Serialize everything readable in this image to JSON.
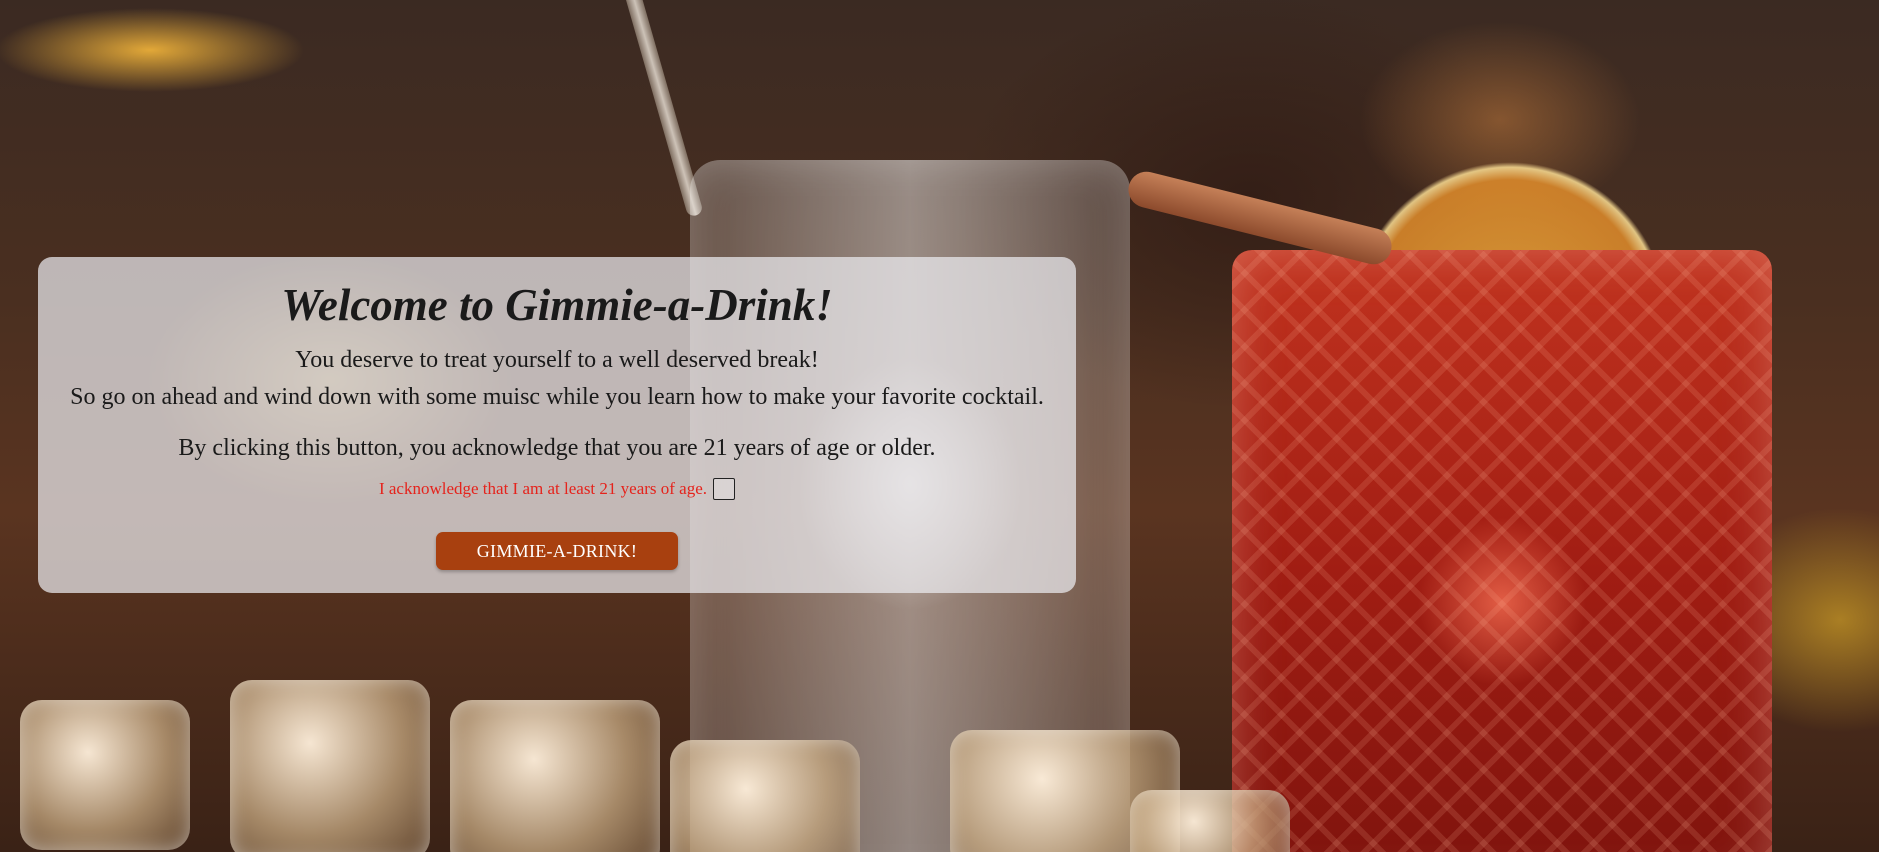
{
  "page": {
    "title": "Welcome to Gimmie-a-Drink!",
    "intro_line1": "You deserve to treat yourself to a well deserved break!",
    "intro_line2": "So go on ahead and wind down with some muisc while you learn how to make your favorite cocktail.",
    "notice": "By clicking this button, you acknowledge that you are 21 years of age or older.",
    "acknowledge_label": "I acknowledge that I am at least 21 years of age.",
    "acknowledge_checked": false,
    "button_label": "GIMMIE-A-DRINK!"
  },
  "colors": {
    "panel_bg": "#ECECF0",
    "acknowledge_text": "#e5231c",
    "button_bg": "#a8400f",
    "button_text": "#ffffff"
  },
  "background": {
    "scene": "bar counter with cocktail glass, orange slice, cinnamon stick, ice cubes"
  }
}
